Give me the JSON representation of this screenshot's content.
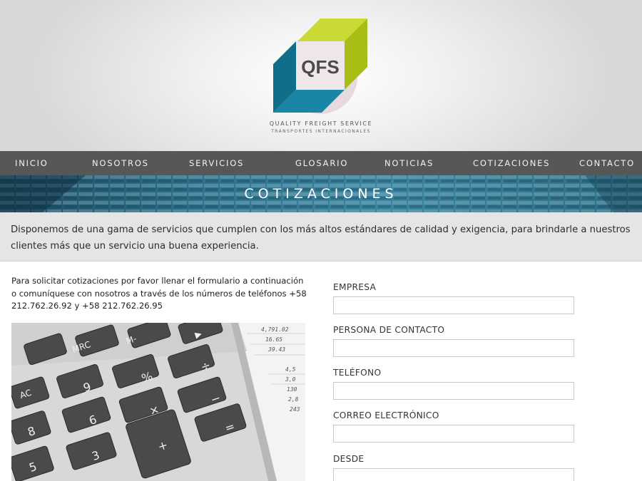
{
  "brand": {
    "logo_text": "QFS",
    "tagline": "QUALITY FREIGHT SERVICE",
    "subtagline": "TRANSPORTES INTERNACIONALES",
    "colors": {
      "lime": "#c3d52a",
      "teal": "#167a98",
      "dark_teal": "#0d5870",
      "pink": "#e9dde2"
    }
  },
  "nav": {
    "items": [
      {
        "label": "INICIO"
      },
      {
        "label": "NOSOTROS"
      },
      {
        "label": "SERVICIOS"
      },
      {
        "label": "GLOSARIO"
      },
      {
        "label": "NOTICIAS"
      },
      {
        "label": "COTIZACIONES"
      },
      {
        "label": "CONTACTO"
      }
    ]
  },
  "banner": {
    "title": "COTIZACIONES"
  },
  "intro": {
    "text": "Disponemos de una gama de servicios que cumplen con los más altos estándares de calidad y exigencia, para brindarle a nuestros clientes más que un servicio una buena experiencia."
  },
  "info": {
    "text": "Para solicitar cotizaciones por favor llenar el formulario a continuación o comuníquese con nosotros a través de los números de teléfonos +58 212.762.26.92 y +58 212.762.26.95"
  },
  "photo": {
    "keys": [
      "MRC",
      "M-",
      "%",
      "÷",
      "×",
      "−",
      "+",
      "=",
      "9",
      "8",
      "6",
      "5",
      "3",
      "AC",
      "▶"
    ],
    "paper_numbers": [
      "4,791.02",
      "16.65",
      "39.43",
      "4,5",
      "3,0",
      "130",
      "2,8",
      "243"
    ]
  },
  "form": {
    "fields": [
      {
        "label": "EMPRESA",
        "value": ""
      },
      {
        "label": "PERSONA DE CONTACTO",
        "value": ""
      },
      {
        "label": "TELÉFONO",
        "value": ""
      },
      {
        "label": "CORREO ELECTRÓNICO",
        "value": ""
      },
      {
        "label": "DESDE",
        "value": ""
      }
    ]
  }
}
